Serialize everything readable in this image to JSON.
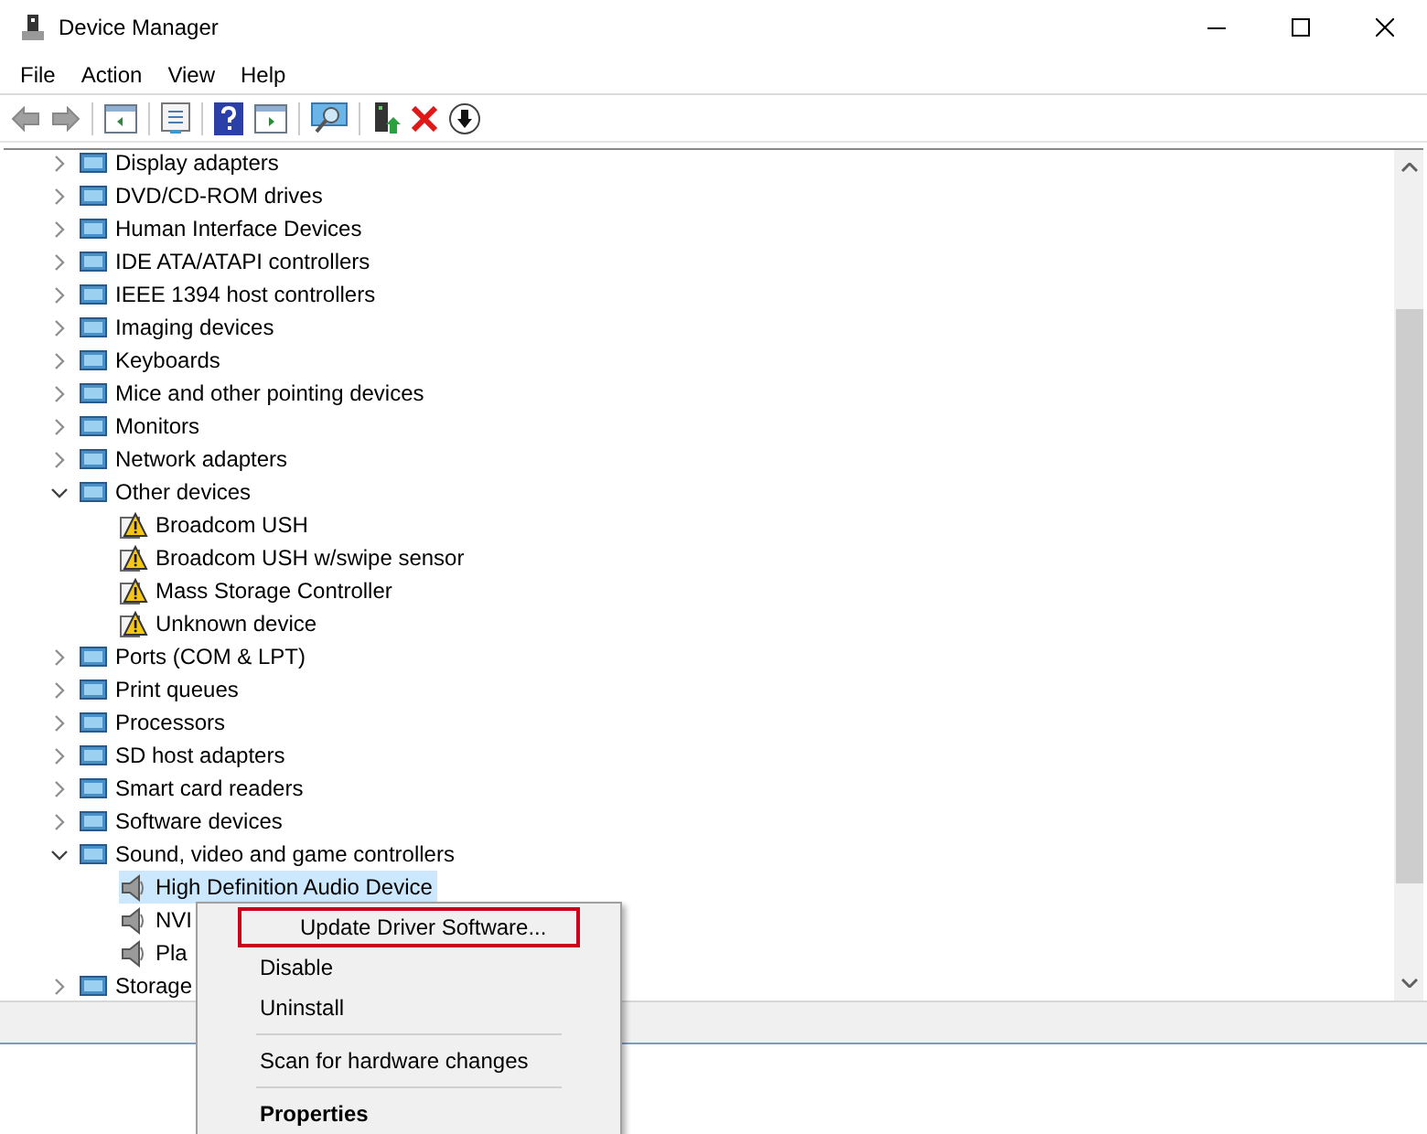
{
  "window": {
    "title": "Device Manager"
  },
  "menu_bar": [
    "File",
    "Action",
    "View",
    "Help"
  ],
  "tree": [
    {
      "label": "Display adapters",
      "expanded": false
    },
    {
      "label": "DVD/CD-ROM drives",
      "expanded": false
    },
    {
      "label": "Human Interface Devices",
      "expanded": false
    },
    {
      "label": "IDE ATA/ATAPI controllers",
      "expanded": false
    },
    {
      "label": "IEEE 1394 host controllers",
      "expanded": false
    },
    {
      "label": "Imaging devices",
      "expanded": false
    },
    {
      "label": "Keyboards",
      "expanded": false
    },
    {
      "label": "Mice and other pointing devices",
      "expanded": false
    },
    {
      "label": "Monitors",
      "expanded": false
    },
    {
      "label": "Network adapters",
      "expanded": false
    },
    {
      "label": "Other devices",
      "expanded": true,
      "children": [
        {
          "label": "Broadcom USH",
          "kind": "unknown",
          "selected": false
        },
        {
          "label": "Broadcom USH w/swipe sensor",
          "kind": "unknown",
          "selected": false
        },
        {
          "label": "Mass Storage Controller",
          "kind": "unknown",
          "selected": false
        },
        {
          "label": "Unknown device",
          "kind": "unknown",
          "selected": false
        }
      ]
    },
    {
      "label": "Ports (COM & LPT)",
      "expanded": false
    },
    {
      "label": "Print queues",
      "expanded": false
    },
    {
      "label": "Processors",
      "expanded": false
    },
    {
      "label": "SD host adapters",
      "expanded": false
    },
    {
      "label": "Smart card readers",
      "expanded": false
    },
    {
      "label": "Software devices",
      "expanded": false
    },
    {
      "label": "Sound, video and game controllers",
      "expanded": true,
      "children": [
        {
          "label": "High Definition Audio Device",
          "kind": "audio",
          "selected": true
        },
        {
          "label": "NVI",
          "kind": "audio",
          "selected": false
        },
        {
          "label": "Pla",
          "kind": "audio",
          "selected": false
        }
      ]
    },
    {
      "label": "Storage",
      "expanded": false
    }
  ],
  "context_menu": {
    "items": [
      {
        "kind": "item",
        "label": "Update Driver Software...",
        "highlighted": true
      },
      {
        "kind": "item",
        "label": "Disable",
        "highlighted": false
      },
      {
        "kind": "item",
        "label": "Uninstall",
        "highlighted": false
      },
      {
        "kind": "separator"
      },
      {
        "kind": "item",
        "label": "Scan for hardware changes",
        "highlighted": false
      },
      {
        "kind": "separator"
      },
      {
        "kind": "default",
        "label": "Properties",
        "highlighted": false
      }
    ]
  }
}
